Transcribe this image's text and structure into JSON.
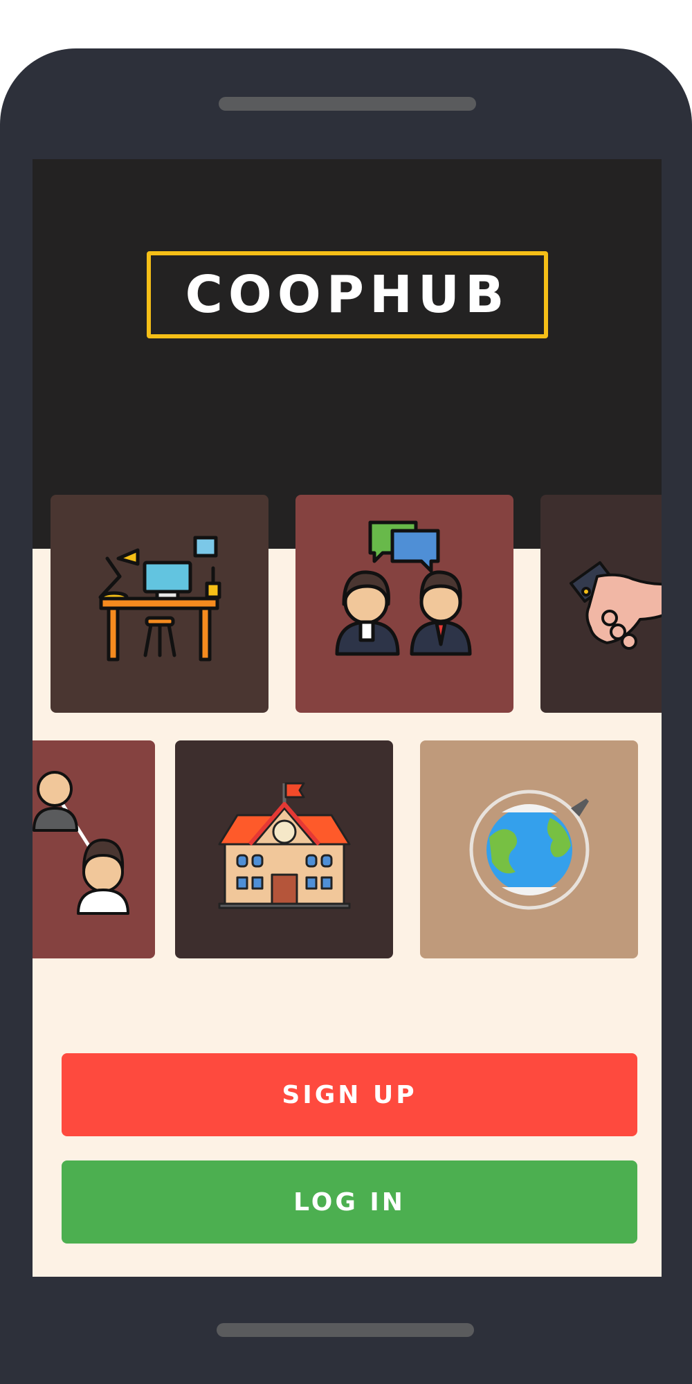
{
  "app": {
    "name": "COOPHUB"
  },
  "tiles": [
    {
      "icon": "workspace-desk-icon",
      "color": "#4a3631"
    },
    {
      "icon": "chat-people-icon",
      "color": "#854240"
    },
    {
      "icon": "handshake-icon",
      "color": "#3d2e2d"
    },
    {
      "icon": "networking-people-icon",
      "color": "#854240"
    },
    {
      "icon": "school-building-icon",
      "color": "#3d2e2d"
    },
    {
      "icon": "globe-airplane-icon",
      "color": "#bf9a7b"
    }
  ],
  "buttons": {
    "signup": {
      "label": "SIGN UP",
      "color": "#fe4a3e"
    },
    "login": {
      "label": "LOG IN",
      "color": "#4caf50"
    }
  },
  "colors": {
    "hero_bg": "#232222",
    "screen_bg": "#fdf2e5",
    "logo_border": "#f5bf17",
    "phone_frame": "#2d303a"
  }
}
